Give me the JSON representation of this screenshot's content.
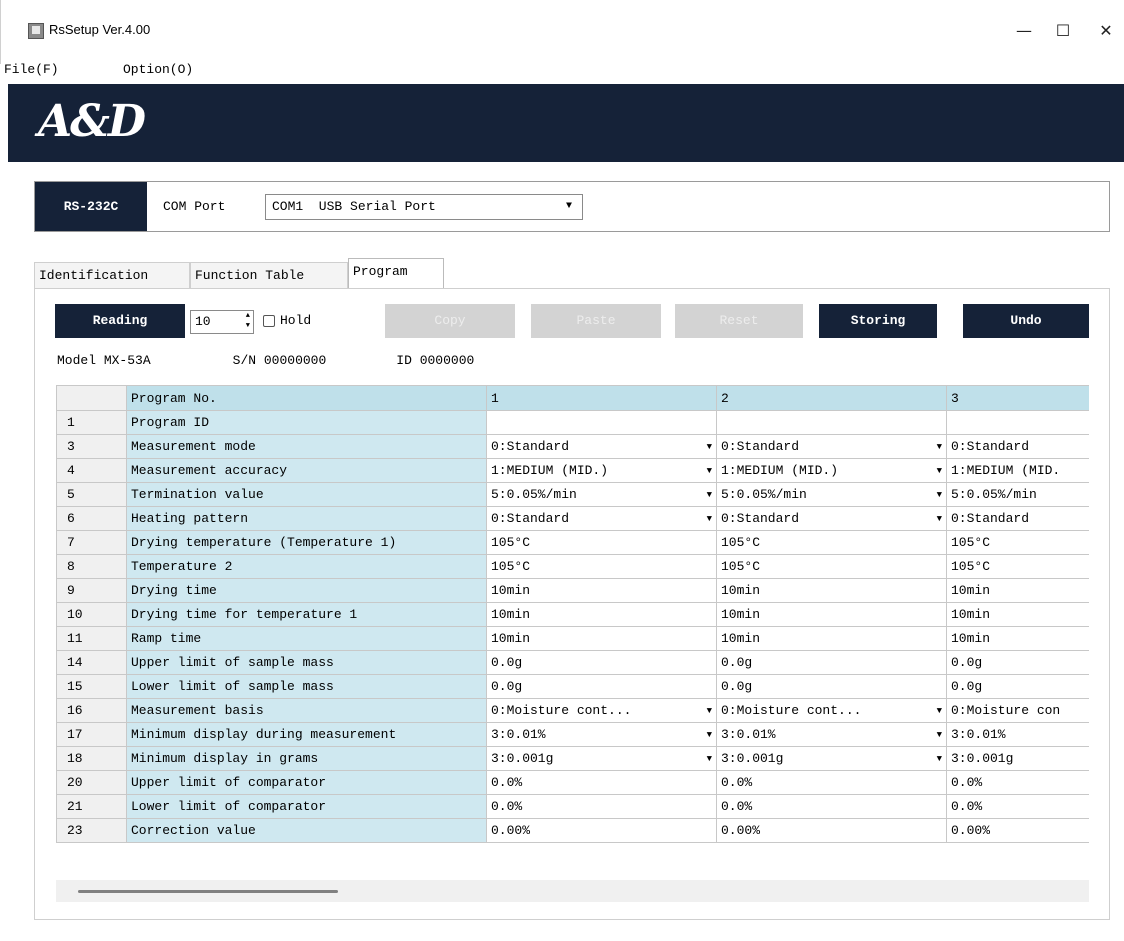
{
  "window": {
    "title": "RsSetup Ver.4.00",
    "minimize": "—",
    "maximize": "☐",
    "close": "✕"
  },
  "menu": {
    "file": "File(F)",
    "option": "Option(O)"
  },
  "brand": {
    "logo_text": "A&D"
  },
  "comm": {
    "interface_label": "RS-232C",
    "port_label": "COM Port",
    "port_value": "COM1  USB Serial Port"
  },
  "tabs": [
    {
      "label": "Identification",
      "active": false
    },
    {
      "label": "Function Table",
      "active": false
    },
    {
      "label": "Program",
      "active": true
    }
  ],
  "toolbar": {
    "reading": "Reading",
    "reading_count": "10",
    "hold": "Hold",
    "copy": "Copy",
    "paste": "Paste",
    "reset": "Reset",
    "storing": "Storing",
    "undo": "Undo"
  },
  "info": {
    "model_label": "Model",
    "model_value": "MX-53A",
    "sn_label": "S/N",
    "sn_value": "00000000",
    "id_label": "ID",
    "id_value": "0000000"
  },
  "table": {
    "header": [
      "Program No.",
      "1",
      "2",
      "3"
    ],
    "rows": [
      {
        "no": "1",
        "name": "Program ID",
        "values": [
          "",
          "",
          ""
        ],
        "dropdown": false
      },
      {
        "no": "3",
        "name": "Measurement mode",
        "values": [
          "0:Standard",
          "0:Standard",
          "0:Standard"
        ],
        "dropdown": true
      },
      {
        "no": "4",
        "name": "Measurement accuracy",
        "values": [
          "1:MEDIUM (MID.)",
          "1:MEDIUM (MID.)",
          "1:MEDIUM (MID."
        ],
        "dropdown": true
      },
      {
        "no": "5",
        "name": "Termination value",
        "values": [
          "5:0.05%/min",
          "5:0.05%/min",
          "5:0.05%/min"
        ],
        "dropdown": true
      },
      {
        "no": "6",
        "name": "Heating pattern",
        "values": [
          "0:Standard",
          "0:Standard",
          "0:Standard"
        ],
        "dropdown": true
      },
      {
        "no": "7",
        "name": "Drying temperature (Temperature 1)",
        "values": [
          "105°C",
          "105°C",
          "105°C"
        ],
        "dropdown": false
      },
      {
        "no": "8",
        "name": "Temperature 2",
        "values": [
          "105°C",
          "105°C",
          "105°C"
        ],
        "dropdown": false
      },
      {
        "no": "9",
        "name": "Drying time",
        "values": [
          "10min",
          "10min",
          "10min"
        ],
        "dropdown": false
      },
      {
        "no": "10",
        "name": "Drying time for temperature 1",
        "values": [
          "10min",
          "10min",
          "10min"
        ],
        "dropdown": false
      },
      {
        "no": "11",
        "name": "Ramp time",
        "values": [
          "10min",
          "10min",
          "10min"
        ],
        "dropdown": false
      },
      {
        "no": "14",
        "name": "Upper limit of sample mass",
        "values": [
          "0.0g",
          "0.0g",
          "0.0g"
        ],
        "dropdown": false
      },
      {
        "no": "15",
        "name": "Lower limit of sample mass",
        "values": [
          "0.0g",
          "0.0g",
          "0.0g"
        ],
        "dropdown": false
      },
      {
        "no": "16",
        "name": "Measurement basis",
        "values": [
          "0:Moisture cont...",
          "0:Moisture cont...",
          "0:Moisture con"
        ],
        "dropdown": true
      },
      {
        "no": "17",
        "name": "Minimum display during measurement",
        "values": [
          "3:0.01%",
          "3:0.01%",
          "3:0.01%"
        ],
        "dropdown": true
      },
      {
        "no": "18",
        "name": "Minimum display in grams",
        "values": [
          "3:0.001g",
          "3:0.001g",
          "3:0.001g"
        ],
        "dropdown": true
      },
      {
        "no": "20",
        "name": "Upper limit of comparator",
        "values": [
          "0.0%",
          "0.0%",
          "0.0%"
        ],
        "dropdown": false
      },
      {
        "no": "21",
        "name": "Lower limit of comparator",
        "values": [
          "0.0%",
          "0.0%",
          "0.0%"
        ],
        "dropdown": false
      },
      {
        "no": "23",
        "name": "Correction value",
        "values": [
          "0.00%",
          "0.00%",
          "0.00%"
        ],
        "dropdown": false
      }
    ]
  },
  "colors": {
    "brand_navy": "#152238",
    "row_header_blue": "#cfe8f0",
    "column_header_blue": "#bfe0ea",
    "disabled_button": "#d3d3d3"
  }
}
